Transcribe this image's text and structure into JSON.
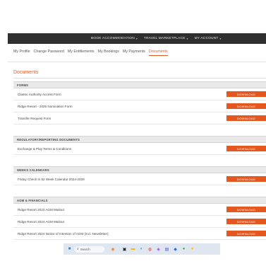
{
  "navbar": {
    "items": [
      {
        "label": "BOOK ACCOMMODATION",
        "has_caret": true
      },
      {
        "label": "TRAVEL MARKETPLACE",
        "has_caret": true
      },
      {
        "label": "MY ACCOUNT",
        "has_caret": true
      }
    ],
    "caret": "▾"
  },
  "subnav": {
    "items": [
      "My Profile",
      "Change Password",
      "My Entitlements",
      "My Bookings",
      "My Payments",
      "Documents"
    ],
    "active_index": 5
  },
  "page_title": "Documents",
  "download_label": "DOWNLOAD",
  "sections": [
    {
      "heading": "FORMS",
      "documents": [
        "Classic Authority Access Form",
        "Ridge Resort - 2025 Nomination Form",
        "Transfer Request Form"
      ]
    },
    {
      "heading": "REGULATORY/REPORTING DOCUMENTS",
      "documents": [
        "Exchange & Play Terms & Conditions"
      ]
    },
    {
      "heading": "WEEKS CALENDARS",
      "documents": [
        "Friday Check In 52 Week Calendar 2024-2029"
      ]
    },
    {
      "heading": "AGM & FINANCIALS",
      "documents": [
        "Ridge Resort 2023 AGM Mailout",
        "Ridge Resort 2024 AGM Mailout",
        "Ridge Resort 2024 Notice of Intention of AGM (incl. Newsletter)"
      ]
    }
  ],
  "taskbar": {
    "search_placeholder": "Search",
    "icons": [
      {
        "name": "windows-start-icon",
        "glyph": "■",
        "color": "#1e88e5"
      },
      {
        "name": "search-icon",
        "glyph": "⌕",
        "color": "#333333"
      },
      {
        "name": "widgets-icon",
        "glyph": "◉",
        "color": "#ef8a2a"
      },
      {
        "name": "task-view-icon",
        "glyph": "▣",
        "color": "#2b2b2b"
      },
      {
        "name": "file-explorer-icon",
        "glyph": "▬",
        "color": "#f2b705"
      },
      {
        "name": "edge-icon",
        "glyph": "◐",
        "color": "#1e9bd7"
      },
      {
        "name": "chrome-icon",
        "glyph": "◍",
        "color": "#e0442f"
      },
      {
        "name": "store-icon",
        "glyph": "◈",
        "color": "#8a4fd6"
      },
      {
        "name": "teams-icon",
        "glyph": "▤",
        "color": "#4b53bc"
      },
      {
        "name": "outlook-icon",
        "glyph": "◆",
        "color": "#2a6fd6"
      },
      {
        "name": "app-icon",
        "glyph": "●",
        "color": "#34a853"
      },
      {
        "name": "app-icon-2",
        "glyph": "●",
        "color": "#fbbc05"
      }
    ]
  },
  "colors": {
    "accent": "#e05a24",
    "button": "#e4581f",
    "navbar": "#2f2f2f",
    "section_header": "#e9e9e9"
  }
}
